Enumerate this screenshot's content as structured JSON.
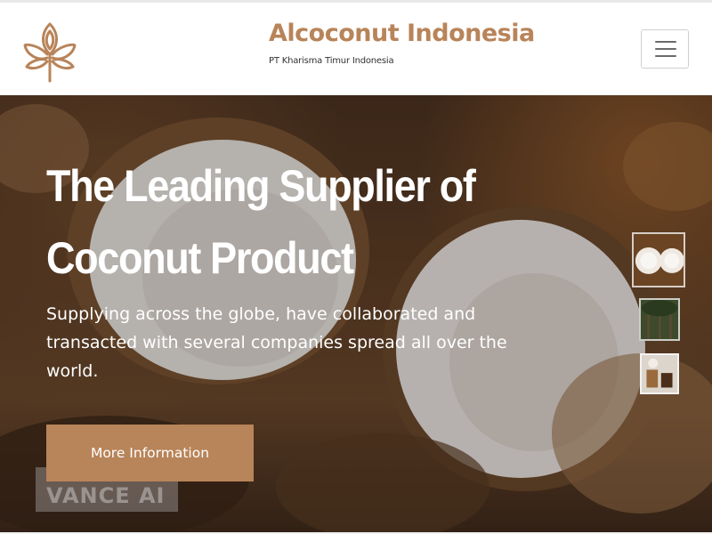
{
  "header": {
    "brand_title": "Alcoconut Indonesia",
    "brand_subtitle": "PT Kharisma Timur Indonesia",
    "logo_icon": "lotus-leaf-logo",
    "menu_icon": "hamburger-menu-icon"
  },
  "hero": {
    "title_line1": "The Leading Supplier of",
    "title_line2": "Coconut Product",
    "text": "Supplying across the globe, have collaborated and transacted with several companies spread all over the world.",
    "cta_label": "More Information",
    "watermark": "VANCE AI",
    "thumbnails": [
      "coconut-halves-thumbnail",
      "coconut-trees-thumbnail",
      "coconut-products-thumbnail"
    ]
  },
  "colors": {
    "accent": "#b88459",
    "text_dark": "#333333",
    "hero_text": "#ffffff"
  }
}
